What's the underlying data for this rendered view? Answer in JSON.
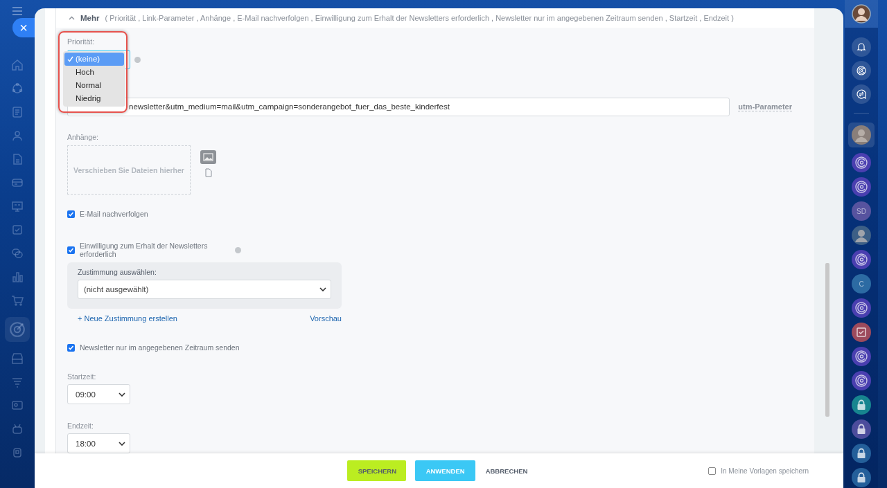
{
  "close_button": "×",
  "header": {
    "toggle": "Mehr",
    "expanded": true,
    "summary": "( Priorität ,  Link-Parameter ,  Anhänge ,  E-Mail nachverfolgen ,  Einwilligung zum Erhalt der Newsletters erforderlich ,  Newsletter nur im angegebenen Zeitraum senden ,  Startzeit ,  Endzeit )"
  },
  "priority": {
    "label": "Priorität:",
    "options": [
      {
        "label": "(keine)",
        "selected": true
      },
      {
        "label": "Hoch",
        "selected": false
      },
      {
        "label": "Normal",
        "selected": false
      },
      {
        "label": "Niedrig",
        "selected": false
      }
    ]
  },
  "link": {
    "value": "newsletter&utm_medium=mail&utm_campaign=sonderangebot_fuer_das_beste_kinderfest",
    "utm_link": "utm-Parameter"
  },
  "attachments": {
    "label": "Anhänge:",
    "dropzone": "Verschieben Sie Dateien hierher"
  },
  "track_email": {
    "label": "E-Mail nachverfolgen",
    "checked": true
  },
  "consent": {
    "label": "Einwilligung zum Erhalt der Newsletters erforderlich",
    "checked": true,
    "select_label": "Zustimmung auswählen:",
    "select_value": "(nicht ausgewählt)",
    "create_link": "+ Neue Zustimmung erstellen",
    "preview_link": "Vorschau"
  },
  "period": {
    "label": "Newsletter nur im angegebenen Zeitraum senden",
    "checked": true
  },
  "start": {
    "label": "Startzeit:",
    "value": "09:00"
  },
  "end": {
    "label": "Endzeit:",
    "value": "18:00"
  },
  "footer": {
    "save": "SPEICHERN",
    "apply": "ANWENDEN",
    "cancel": "ABBRECHEN",
    "template": {
      "label": "In Meine Vorlagen speichern",
      "checked": false
    }
  },
  "rail": [
    {
      "kind": "avatar",
      "color": "#8a7f7a"
    },
    {
      "kind": "logo",
      "color": "#4a3fb0"
    },
    {
      "kind": "logo",
      "color": "#4a3fb0"
    },
    {
      "kind": "initials",
      "text": "SD",
      "color": "#57539f"
    },
    {
      "kind": "avatar",
      "color": "#3d5f86"
    },
    {
      "kind": "logo",
      "color": "#4a3fb0"
    },
    {
      "kind": "initials",
      "text": "C",
      "color": "#2c6ba3"
    },
    {
      "kind": "logo",
      "color": "#4a3fb0"
    },
    {
      "kind": "task",
      "color": "#9c4a5c"
    },
    {
      "kind": "logo",
      "color": "#4a3fb0"
    },
    {
      "kind": "logo",
      "color": "#4a3fb0"
    },
    {
      "kind": "lock",
      "color": "#17858f"
    },
    {
      "kind": "lock",
      "color": "#4c4c9c"
    },
    {
      "kind": "lock",
      "color": "#245f9a"
    },
    {
      "kind": "lock",
      "color": "#245f9a"
    }
  ]
}
